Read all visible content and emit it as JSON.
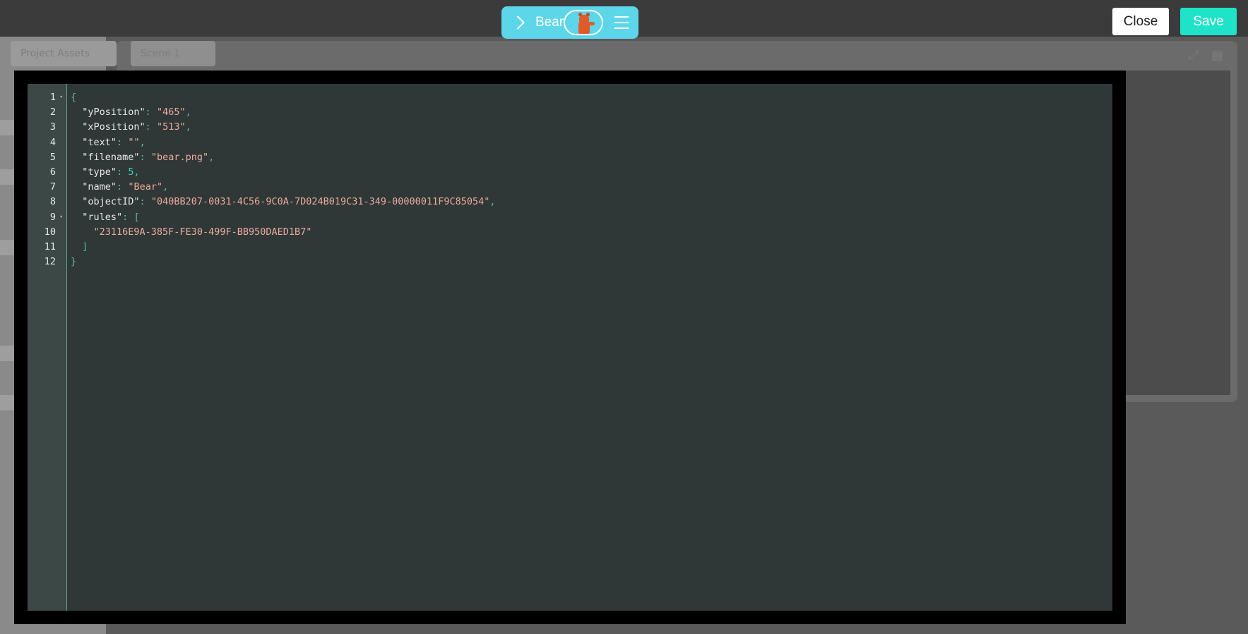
{
  "background": {
    "tab_project": "Project Assets",
    "tab_scene": "Scene 1"
  },
  "header": {
    "object_name": "Bear",
    "thumbnail": "bear-thumbnail",
    "close_label": "Close",
    "save_label": "Save"
  },
  "editor": {
    "lines": [
      {
        "n": "1",
        "fold": true
      },
      {
        "n": "2",
        "key": "\"yPosition\"",
        "value": "\"465\"",
        "vtype": "str",
        "comma": true
      },
      {
        "n": "3",
        "key": "\"xPosition\"",
        "value": "\"513\"",
        "vtype": "str",
        "comma": true
      },
      {
        "n": "4",
        "key": "\"text\"",
        "value": "\"\"",
        "vtype": "str",
        "comma": true
      },
      {
        "n": "5",
        "key": "\"filename\"",
        "value": "\"bear.png\"",
        "vtype": "str",
        "comma": true
      },
      {
        "n": "6",
        "key": "\"type\"",
        "value": "5",
        "vtype": "num",
        "comma": true
      },
      {
        "n": "7",
        "key": "\"name\"",
        "value": "\"Bear\"",
        "vtype": "str",
        "comma": true
      },
      {
        "n": "8",
        "key": "\"objectID\"",
        "value": "\"040BB207-0031-4C56-9C0A-7D024B019C31-349-00000011F9C85054\"",
        "vtype": "str",
        "comma": true
      },
      {
        "n": "9",
        "key": "\"rules\"",
        "value": "[",
        "vtype": "punct",
        "fold": true
      },
      {
        "n": "10",
        "item": "\"23116E9A-385F-FE30-499F-BB950DAED1B7\""
      },
      {
        "n": "11",
        "close": "]"
      },
      {
        "n": "12",
        "close": "}"
      }
    ]
  },
  "colors": {
    "pill": "#5dd6ea",
    "save": "#1fe3c8",
    "editor_bg": "#2f3836",
    "gutter_bg": "#3b4845"
  }
}
